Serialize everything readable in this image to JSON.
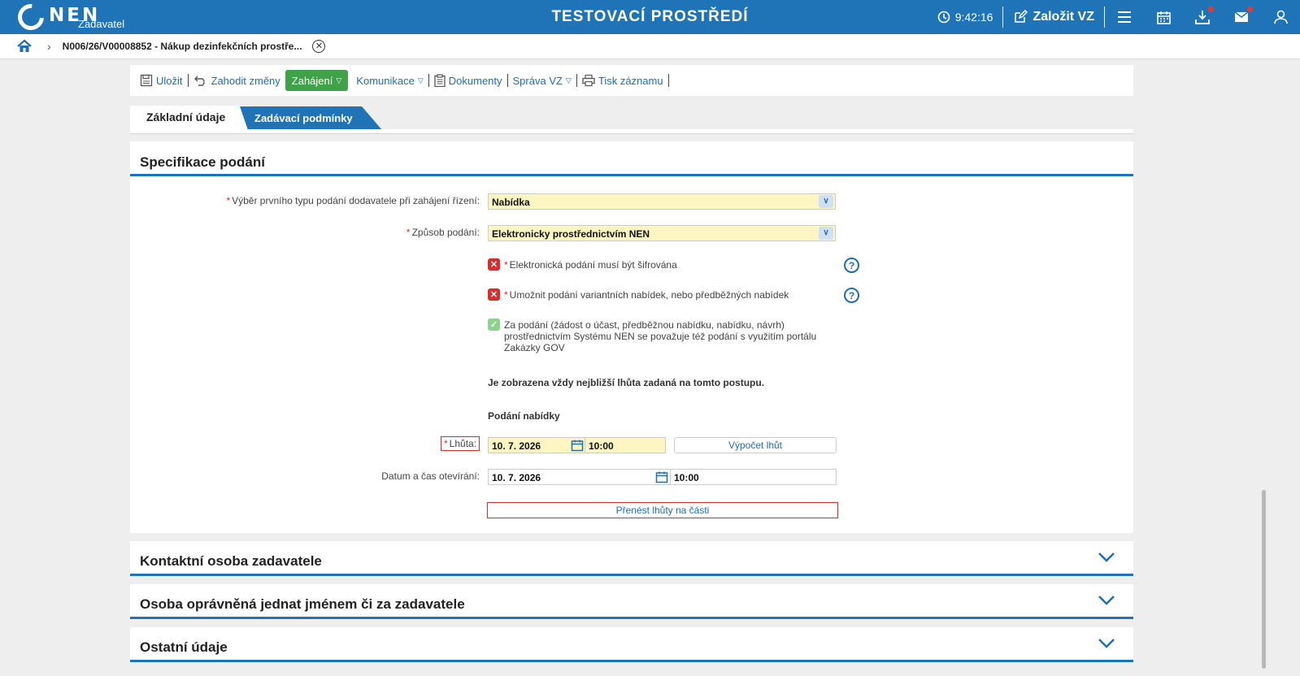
{
  "header": {
    "logo_text": "NEN",
    "logo_sub": "Zadavatel",
    "env_title": "TESTOVACÍ PROSTŘEDÍ",
    "time": "9:42:16",
    "create_label": "Založit VZ",
    "icons": [
      "clock-icon",
      "edit-icon",
      "menu-icon",
      "calendar-icon",
      "download-icon",
      "mail-icon",
      "user-icon"
    ],
    "accent": "#1f74b8"
  },
  "breadcrumb": {
    "item": "N006/26/V00008852 - Nákup dezinfekčních prostře..."
  },
  "toolbar": {
    "save": "Uložit",
    "discard": "Zahodit změny",
    "start": "Zahájení",
    "communication": "Komunikace",
    "documents": "Dokumenty",
    "management": "Správa VZ",
    "print": "Tisk záznamu"
  },
  "tabs": {
    "basic": "Základní údaje",
    "conditions": "Zadávací podmínky"
  },
  "spec": {
    "title": "Specifikace podání",
    "first_type_label": "Výběr prvního typu podání dodavatele při zahájení řízení:",
    "first_type_value": "Nabídka",
    "method_label": "Způsob podání:",
    "method_value": "Elektronicky prostřednictvím NEN",
    "encrypted_label": "Elektronická podání musí být šifrována",
    "variant_label": "Umožnit podání variantních nabídek, nebo předběžných nabídek",
    "gov_label": "Za podání (žádost o účast, předběžnou nabídku, nabídku, návrh) prostřednictvím Systému NEN se považuje též podání s využitím portálu Zakázky GOV",
    "nearest_note": "Je zobrazena vždy nejbližší lhůta zadaná na tomto postupu.",
    "offer_heading": "Podání nabídky",
    "deadline_label": "Lhůta:",
    "deadline_date": "10. 7. 2026",
    "deadline_time": "10:00",
    "calc_button": "Výpočet lhůt",
    "opening_label": "Datum a čas otevírání:",
    "opening_date": "10. 7. 2026",
    "opening_time": "10:00",
    "transfer_button": "Přenést lhůty na části"
  },
  "sections": {
    "contact": "Kontaktní osoba zadavatele",
    "authorized": "Osoba oprávněná jednat jménem či za zadavatele",
    "other": "Ostatní údaje"
  }
}
